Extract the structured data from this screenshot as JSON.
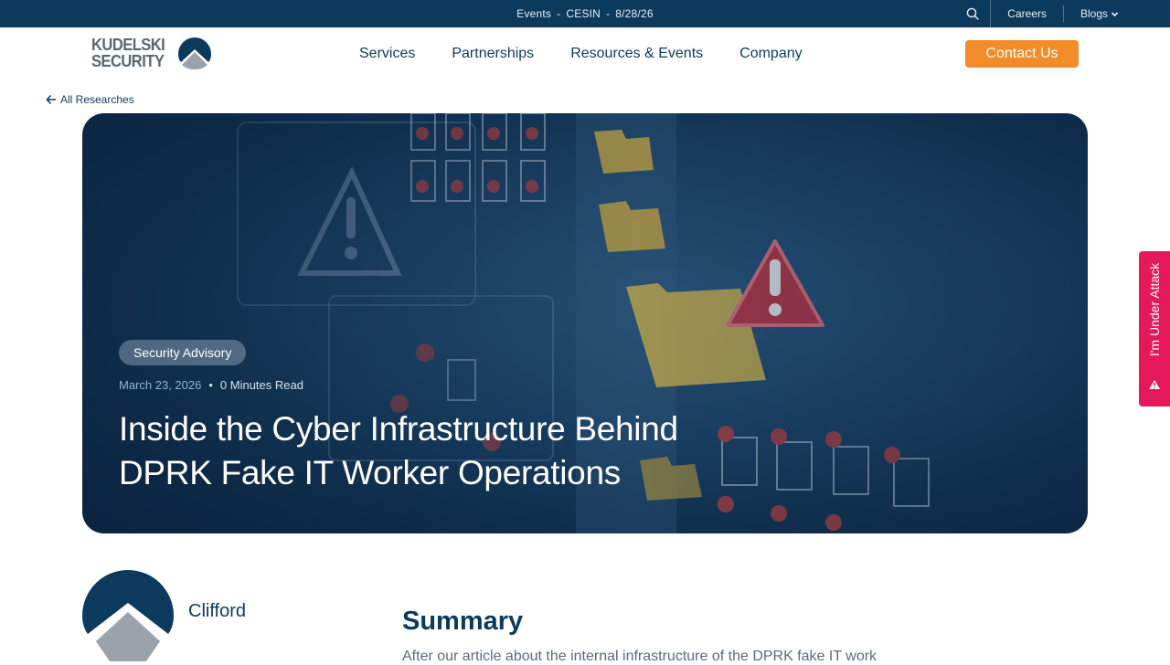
{
  "topbar": {
    "announcement": {
      "label": "Events",
      "event": "CESIN",
      "date": "8/28/26",
      "separator": "-"
    },
    "links": {
      "careers": "Careers",
      "blogs": "Blogs"
    }
  },
  "header": {
    "logo_text": {
      "line1": "KUDELSKI",
      "line2": "SECURITY"
    },
    "nav": [
      "Services",
      "Partnerships",
      "Resources & Events",
      "Company"
    ],
    "cta_label": "Contact Us"
  },
  "back_link": "All Researches",
  "hero": {
    "tag": "Security Advisory",
    "date": "March 23, 2026",
    "meta_separator": "•",
    "read_time": "0 Minutes Read",
    "title": "Inside the Cyber Infrastructure Behind DPRK Fake IT Worker Operations"
  },
  "side_tab": {
    "label": "I'm Under Attack"
  },
  "author": {
    "name": "Clifford"
  },
  "article": {
    "section_title": "Summary",
    "body_start": "After our article about the internal infrastructure of the DPRK fake IT work"
  },
  "colors": {
    "brand_navy": "#0b3a5c",
    "accent_orange": "#f28c28",
    "alert_pink": "#e5195a"
  }
}
